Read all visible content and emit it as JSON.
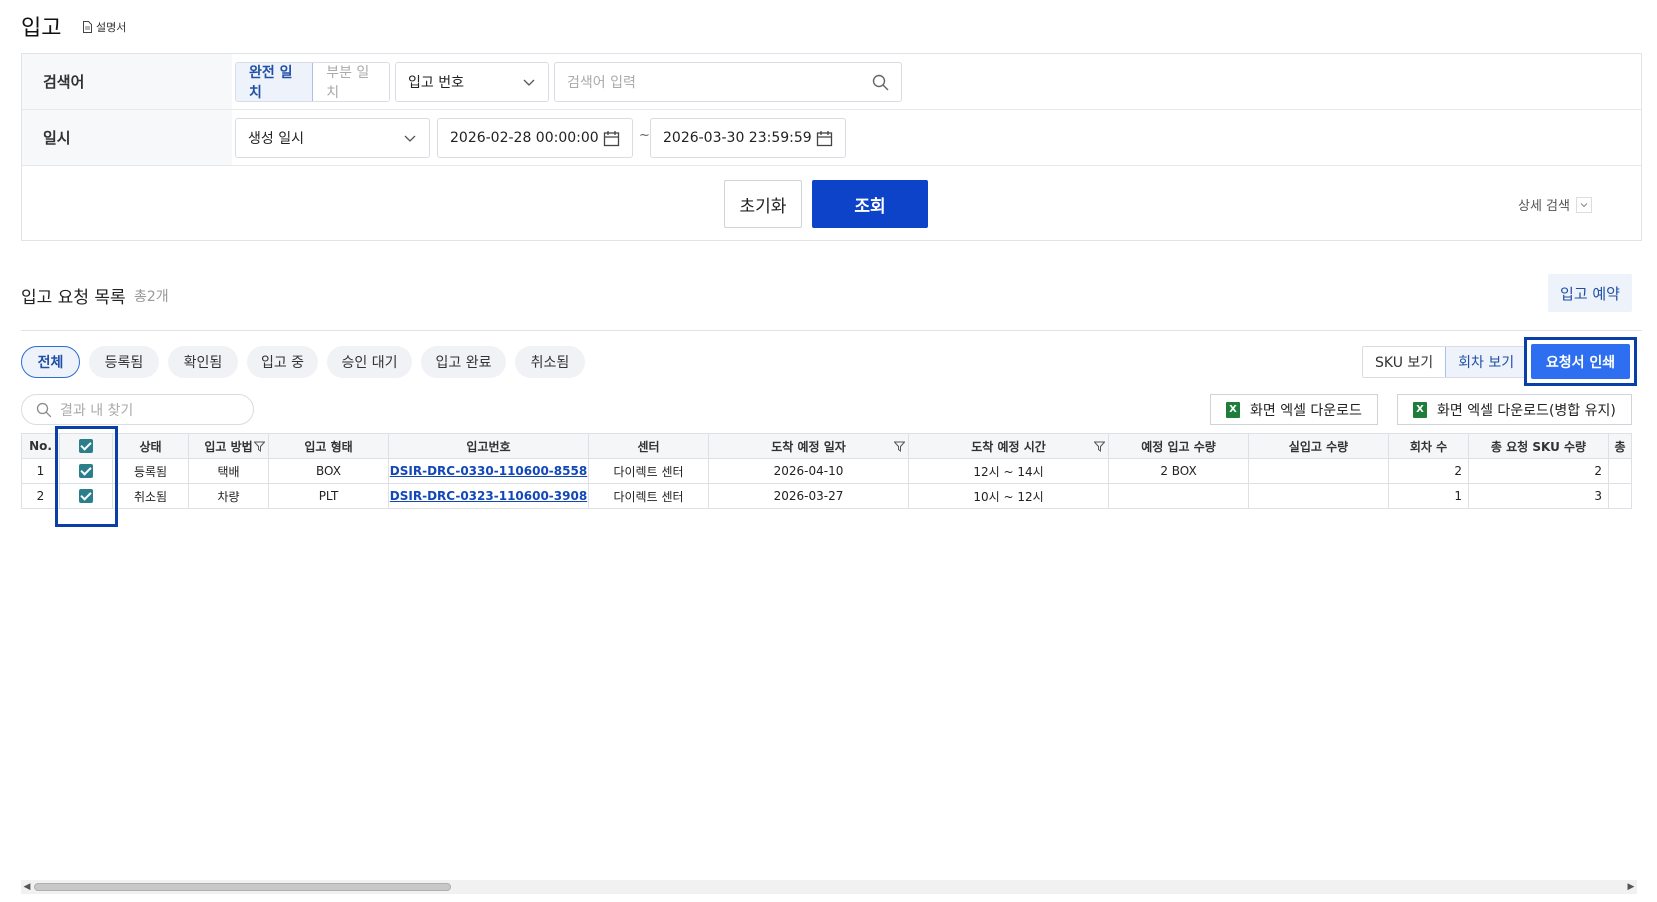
{
  "page": {
    "title": "입고",
    "manual_label": "설명서"
  },
  "search": {
    "keyword_label": "검색어",
    "match_exact": "완전 일치",
    "match_partial": "부분 일치",
    "field_select": "입고 번호",
    "keyword_placeholder": "검색어 입력",
    "date_label": "일시",
    "date_type_select": "생성 일시",
    "date_from": "2026-02-28 00:00:00",
    "date_to": "2026-03-30 23:59:59",
    "tilde": "~",
    "reset_label": "초기화",
    "search_label": "조회",
    "advanced_label": "상세 검색"
  },
  "list": {
    "title": "입고 요청 목록",
    "count": "총2개",
    "reserve_label": "입고 예약",
    "filters": [
      "전체",
      "등록됨",
      "확인됨",
      "입고 중",
      "승인 대기",
      "입고 완료",
      "취소됨"
    ],
    "view_sku": "SKU 보기",
    "view_round": "회차 보기",
    "print_label": "요청서 인쇄",
    "result_search_placeholder": "결과 내 찾기",
    "excel_download": "화면 엑셀 다운로드",
    "excel_download_merged": "화면 엑셀 다운로드(병합 유지)"
  },
  "table": {
    "headers": [
      "No.",
      "",
      "상태",
      "입고 방법",
      "입고 형태",
      "입고번호",
      "센터",
      "도착 예정 일자",
      "도착 예정 시간",
      "예정 입고 수량",
      "실입고 수량",
      "회차 수",
      "총 요청 SKU 수량",
      "총"
    ],
    "rows": [
      {
        "no": "1",
        "status": "등록됨",
        "method": "택배",
        "type": "BOX",
        "number": "DSIR-DRC-0330-110600-8558",
        "center": "다이렉트 센터",
        "arrival_date": "2026-04-10",
        "arrival_time": "12시 ~ 14시",
        "planned_qty": "2 BOX",
        "actual_qty": "",
        "rounds": "2",
        "sku_qty": "2"
      },
      {
        "no": "2",
        "status": "취소됨",
        "method": "차량",
        "type": "PLT",
        "number": "DSIR-DRC-0323-110600-3908",
        "center": "다이렉트 센터",
        "arrival_date": "2026-03-27",
        "arrival_time": "10시 ~ 12시",
        "planned_qty": "",
        "actual_qty": "",
        "rounds": "1",
        "sku_qty": "3"
      }
    ]
  },
  "colors": {
    "primary": "#0c43c9",
    "print_button": "#2d6ff0",
    "highlight_border": "#0a3ea8",
    "link": "#1247b8",
    "checkbox": "#2b7f8a"
  }
}
